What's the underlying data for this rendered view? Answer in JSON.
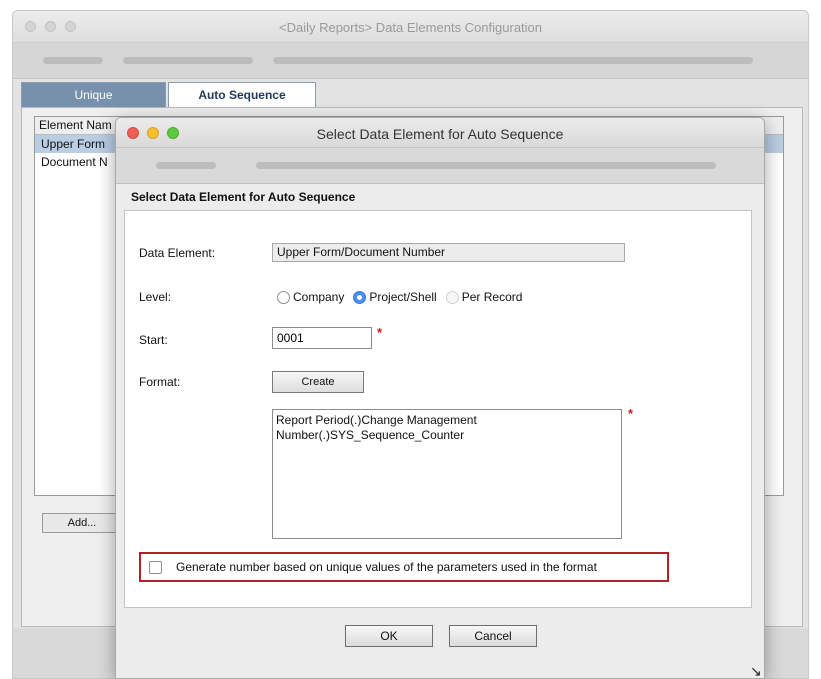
{
  "parent_window": {
    "title": "<Daily Reports> Data Elements Configuration",
    "tabs": [
      {
        "label": "Unique",
        "active": false
      },
      {
        "label": "Auto Sequence",
        "active": true
      }
    ],
    "list": {
      "header": "Element Nam",
      "rows": [
        "Upper Form",
        "Document N"
      ]
    },
    "add_button": "Add..."
  },
  "dialog": {
    "title": "Select Data Element for Auto Sequence",
    "section_header": "Select Data Element for Auto Sequence",
    "data_element": {
      "label": "Data Element:",
      "value": "Upper Form/Document Number"
    },
    "level": {
      "label": "Level:",
      "options": [
        {
          "label": "Company",
          "checked": false,
          "disabled": false
        },
        {
          "label": "Project/Shell",
          "checked": true,
          "disabled": false
        },
        {
          "label": "Per Record",
          "checked": false,
          "disabled": true
        }
      ]
    },
    "start": {
      "label": "Start:",
      "value": "0001",
      "required_mark": "*"
    },
    "format": {
      "label": "Format:",
      "create_button": "Create",
      "value": "Report Period(.)Change Management Number(.)SYS_Sequence_Counter",
      "required_mark": "*"
    },
    "generate_unique": {
      "label": "Generate number based on unique values of the parameters used in the format",
      "checked": false
    },
    "ok_button": "OK",
    "cancel_button": "Cancel"
  },
  "colors": {
    "highlight_border": "#b0222a",
    "required": "#d11c1c",
    "tab_unique_bg": "#7791ac",
    "selected_row": "#b9cde3"
  }
}
